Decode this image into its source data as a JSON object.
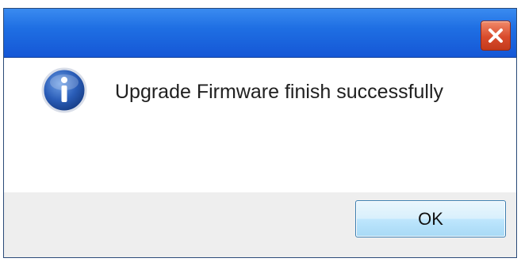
{
  "dialog": {
    "message": "Upgrade Firmware finish successfully",
    "icon": "info-icon",
    "close_icon": "close-icon",
    "ok_label": "OK"
  },
  "colors": {
    "titlebar": "#1f6fe3",
    "close_button": "#d94b2c",
    "info_icon": "#1d4fa8",
    "ok_button_border": "#3c7fb1"
  }
}
